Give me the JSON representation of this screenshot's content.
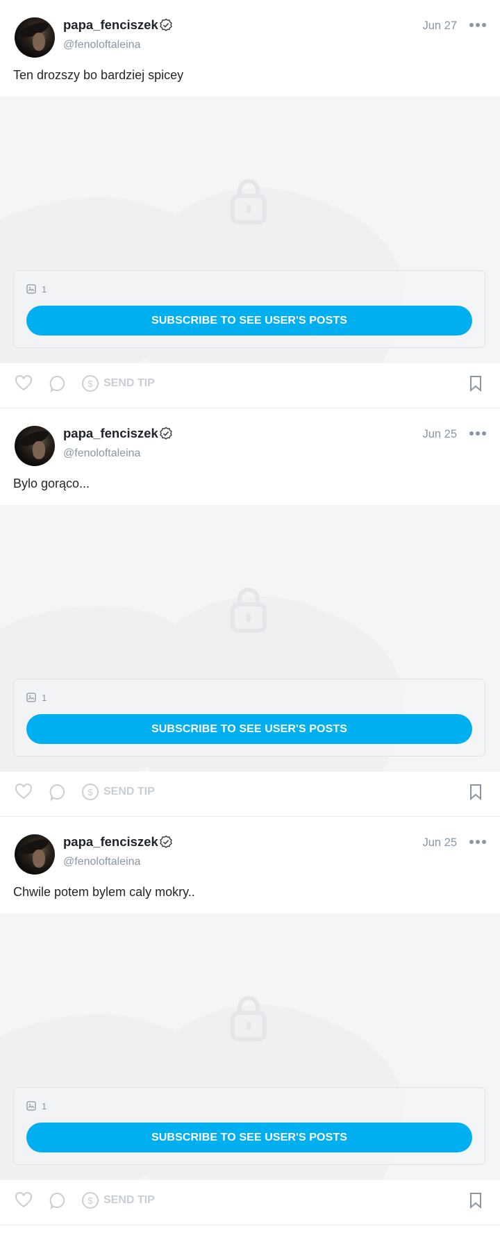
{
  "posts": [
    {
      "username": "papa_fenciszek",
      "handle": "@fenoloftaleina",
      "date": "Jun 27",
      "text": "Ten drozszy bo bardziej spicey",
      "media_count": "1",
      "subscribe_label": "SUBSCRIBE TO SEE USER'S POSTS",
      "send_tip_label": "SEND TIP"
    },
    {
      "username": "papa_fenciszek",
      "handle": "@fenoloftaleina",
      "date": "Jun 25",
      "text": "Bylo gorąco...",
      "media_count": "1",
      "subscribe_label": "SUBSCRIBE TO SEE USER'S POSTS",
      "send_tip_label": "SEND TIP"
    },
    {
      "username": "papa_fenciszek",
      "handle": "@fenoloftaleina",
      "date": "Jun 25",
      "text": "Chwile potem bylem caly mokry..",
      "media_count": "1",
      "subscribe_label": "SUBSCRIBE TO SEE USER'S POSTS",
      "send_tip_label": "SEND TIP"
    }
  ],
  "icons": {
    "verified": "verified-badge-icon",
    "more": "more-dots-icon",
    "lock": "lock-icon",
    "image": "image-icon",
    "like": "heart-icon",
    "comment": "comment-icon",
    "tip": "dollar-coin-icon",
    "bookmark": "bookmark-icon"
  },
  "colors": {
    "accent": "#00aff0",
    "muted": "#8a96a3",
    "disabled": "#c9ced4"
  }
}
